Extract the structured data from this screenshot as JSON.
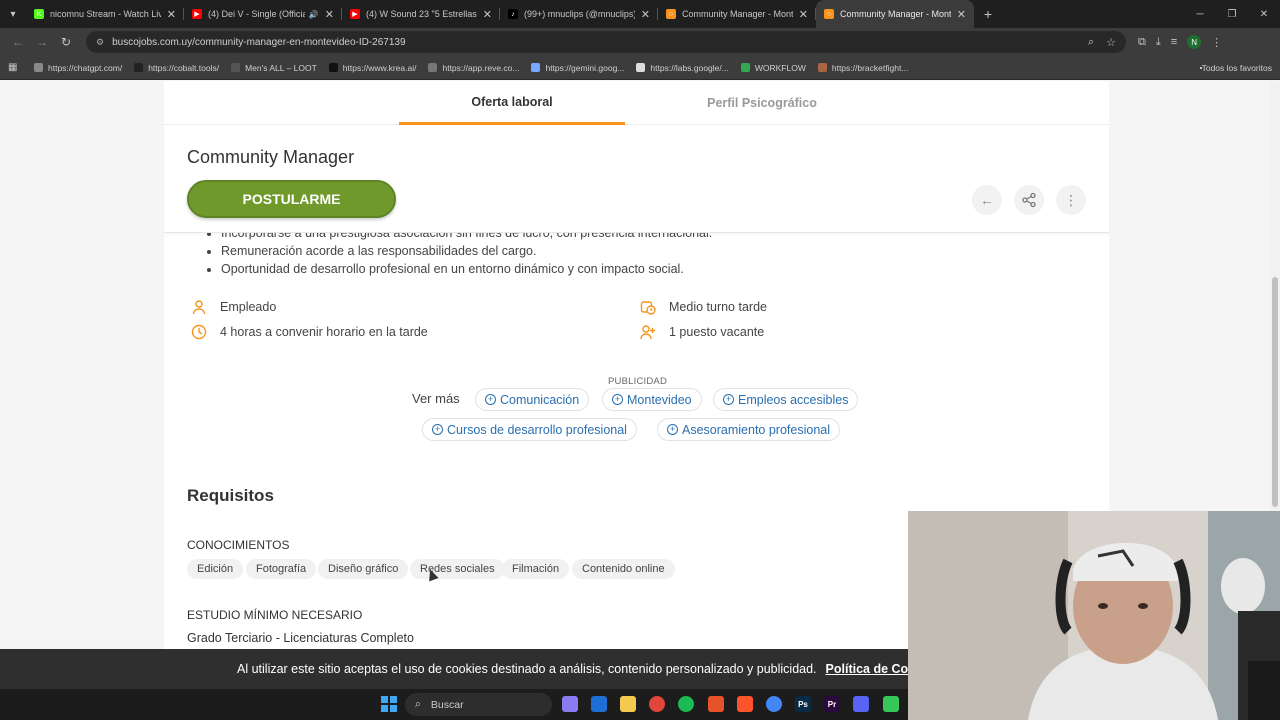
{
  "browser": {
    "tabs": [
      {
        "title": "nicomnu Stream - Watch Live o",
        "color": "#53fc18",
        "glyph": "K",
        "active": false
      },
      {
        "title": "(4) Dei V - Single (Official V",
        "color": "#ff0000",
        "glyph": "▶",
        "active": false,
        "audio": true
      },
      {
        "title": "(4) W Sound 23 \"5 Estrellas\" - N",
        "color": "#ff0000",
        "glyph": "▶",
        "active": false
      },
      {
        "title": "(99+) mnuclips (@mnuclips) | Ti",
        "color": "#000000",
        "glyph": "♪",
        "active": false
      },
      {
        "title": "Community Manager - Montev",
        "color": "#f7941d",
        "glyph": "○",
        "active": false
      },
      {
        "title": "Community Manager - Montev",
        "color": "#f7941d",
        "glyph": "○",
        "active": true
      }
    ],
    "url": "buscojobs.com.uy/community-manager-en-montevideo-ID-267139",
    "profile_initial": "N",
    "bookmarks": [
      {
        "label": "https://chatgpt.com/",
        "color": "#888888"
      },
      {
        "label": "https://cobalt.tools/",
        "color": "#222222"
      },
      {
        "label": "Men's ALL – LOOT",
        "color": "#555555"
      },
      {
        "label": "https://www.krea.ai/",
        "color": "#111111"
      },
      {
        "label": "https://app.reve.co...",
        "color": "#777777"
      },
      {
        "label": "https://gemini.goog...",
        "color": "#7aa7ff"
      },
      {
        "label": "https://labs.google/...",
        "color": "#dddddd"
      },
      {
        "label": "WORKFLOW",
        "color": "#34a853"
      },
      {
        "label": "https://bracketfight...",
        "color": "#aa6644"
      }
    ],
    "bookmarks_folder": "Todos los favoritos"
  },
  "page": {
    "tabs": {
      "offer": "Oferta laboral",
      "profile": "Perfil Psicográfico"
    },
    "job_title": "Community Manager",
    "apply_label": "POSTULARME",
    "bullets": [
      "Incorporarse a una prestigiosa asociación sin fines de lucro, con presencia internacional.",
      "Remuneración acorde a las responsabilidades del cargo.",
      "Oportunidad de desarrollo profesional en un entorno dinámico y con impacto social."
    ],
    "facts": {
      "employment": "Empleado",
      "hours": "4 horas a convenir horario en la tarde",
      "shift": "Medio turno tarde",
      "vacancies": "1 puesto vacante"
    },
    "category_label": "PUBLICIDAD",
    "see_more": "Ver más",
    "chips": [
      "Comunicación",
      "Montevideo",
      "Empleos accesibles",
      "Cursos de desarrollo profesional",
      "Asesoramiento profesional"
    ],
    "requirements_title": "Requisitos",
    "knowledge_label": "CONOCIMIENTOS",
    "skills": [
      "Edición",
      "Fotografía",
      "Diseño gráfico",
      "Redes sociales",
      "Filmación",
      "Contenido online"
    ],
    "study_label": "ESTUDIO MÍNIMO NECESARIO",
    "study_value": "Grado Terciario - Licenciaturas Completo"
  },
  "cookie": {
    "message": "Al utilizar este sitio aceptas el uso de cookies destinado a análisis, contenido personalizado y publicidad.",
    "link": "Política de Cookies"
  },
  "taskbar": {
    "search_placeholder": "Buscar",
    "apps": [
      {
        "name": "copilot",
        "color": "#8a7cf0"
      },
      {
        "name": "outlook",
        "color": "#1d6fd6"
      },
      {
        "name": "file-explorer",
        "color": "#f2c94c"
      },
      {
        "name": "settings",
        "color": "#e0463a"
      },
      {
        "name": "spotify",
        "color": "#1db954"
      },
      {
        "name": "app-orange",
        "color": "#e8522a"
      },
      {
        "name": "brave",
        "color": "#fb542b"
      },
      {
        "name": "chrome",
        "color": "#4285f4"
      },
      {
        "name": "photoshop",
        "color": "#0b2a44",
        "glyph": "Ps"
      },
      {
        "name": "premiere",
        "color": "#2a0a3d",
        "glyph": "Pr"
      },
      {
        "name": "discord",
        "color": "#5865f2"
      },
      {
        "name": "app-green",
        "color": "#35c75a"
      }
    ]
  },
  "colors": {
    "accent": "#f7941d",
    "apply": "#6f9a2b",
    "link": "#2a6fb0"
  }
}
